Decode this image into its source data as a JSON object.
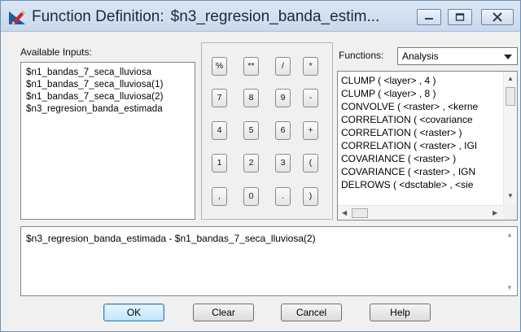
{
  "window": {
    "title_prefix": "Function Definition:",
    "title_expr": "$n3_regresion_banda_estim...",
    "minimize_glyph": "—",
    "maximize_glyph": "□",
    "close_glyph": "X"
  },
  "available_inputs": {
    "label": "Available Inputs:",
    "items": [
      "$n1_bandas_7_seca_lluviosa",
      "$n1_bandas_7_seca_lluviosa(1)",
      "$n1_bandas_7_seca_lluviosa(2)",
      "$n3_regresion_banda_estimada"
    ]
  },
  "keypad": {
    "rows": [
      [
        "%",
        "**",
        "/",
        "*"
      ],
      [
        "7",
        "8",
        "9",
        "-"
      ],
      [
        "4",
        "5",
        "6",
        "+"
      ],
      [
        "1",
        "2",
        "3",
        "("
      ],
      [
        ",",
        "0",
        ".",
        ")"
      ]
    ]
  },
  "functions": {
    "label": "Functions:",
    "selected": "Analysis",
    "items": [
      "CLUMP ( <layer> , 4 )",
      "CLUMP ( <layer> , 8 )",
      "CONVOLVE ( <raster> , <kerne",
      "CORRELATION ( <covariance",
      "CORRELATION ( <raster> )",
      "CORRELATION ( <raster> , IGI",
      "COVARIANCE ( <raster> )",
      "COVARIANCE ( <raster> , IGN",
      "DELROWS ( <dsctable> , <sie"
    ]
  },
  "expression": {
    "value": "$n3_regresion_banda_estimada - $n1_bandas_7_seca_lluviosa(2)"
  },
  "buttons": {
    "ok": "OK",
    "clear": "Clear",
    "cancel": "Cancel",
    "help": "Help"
  },
  "colors": {
    "titlebar": "#cfdcec",
    "dialog_bg": "#f0f0f0",
    "default_button_border": "#3c7fb1"
  }
}
